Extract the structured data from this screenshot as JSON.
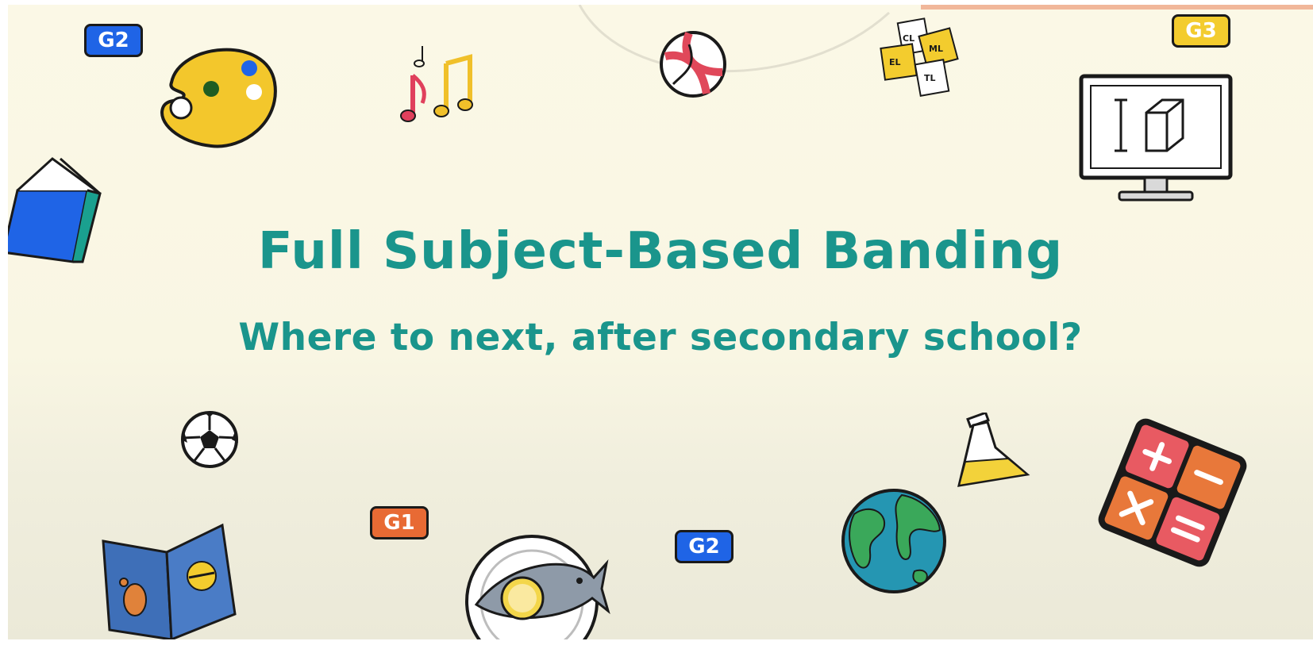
{
  "title": "Full Subject-Based Banding",
  "subtitle": "Where to next, after secondary school?",
  "badges": {
    "g2_top_left": "G2",
    "g3_top_right": "G3",
    "g1_bottom": "G1",
    "g2_bottom": "G2"
  },
  "language_cards": [
    "CL",
    "ML",
    "EL",
    "TL"
  ],
  "colors": {
    "title": "#1a958c",
    "background": "#fbf8e6",
    "badge_blue": "#1f64e6",
    "badge_orange": "#e86a34",
    "badge_yellow": "#f3cc2e"
  },
  "icons": [
    "palette-icon",
    "music-notes-icon",
    "volleyball-icon",
    "language-cards-icon",
    "computer-3d-cube-icon",
    "book-icon",
    "soccer-ball-icon",
    "open-storybook-icon",
    "fish-plate-icon",
    "globe-icon",
    "conical-flask-icon",
    "calculator-icon"
  ]
}
